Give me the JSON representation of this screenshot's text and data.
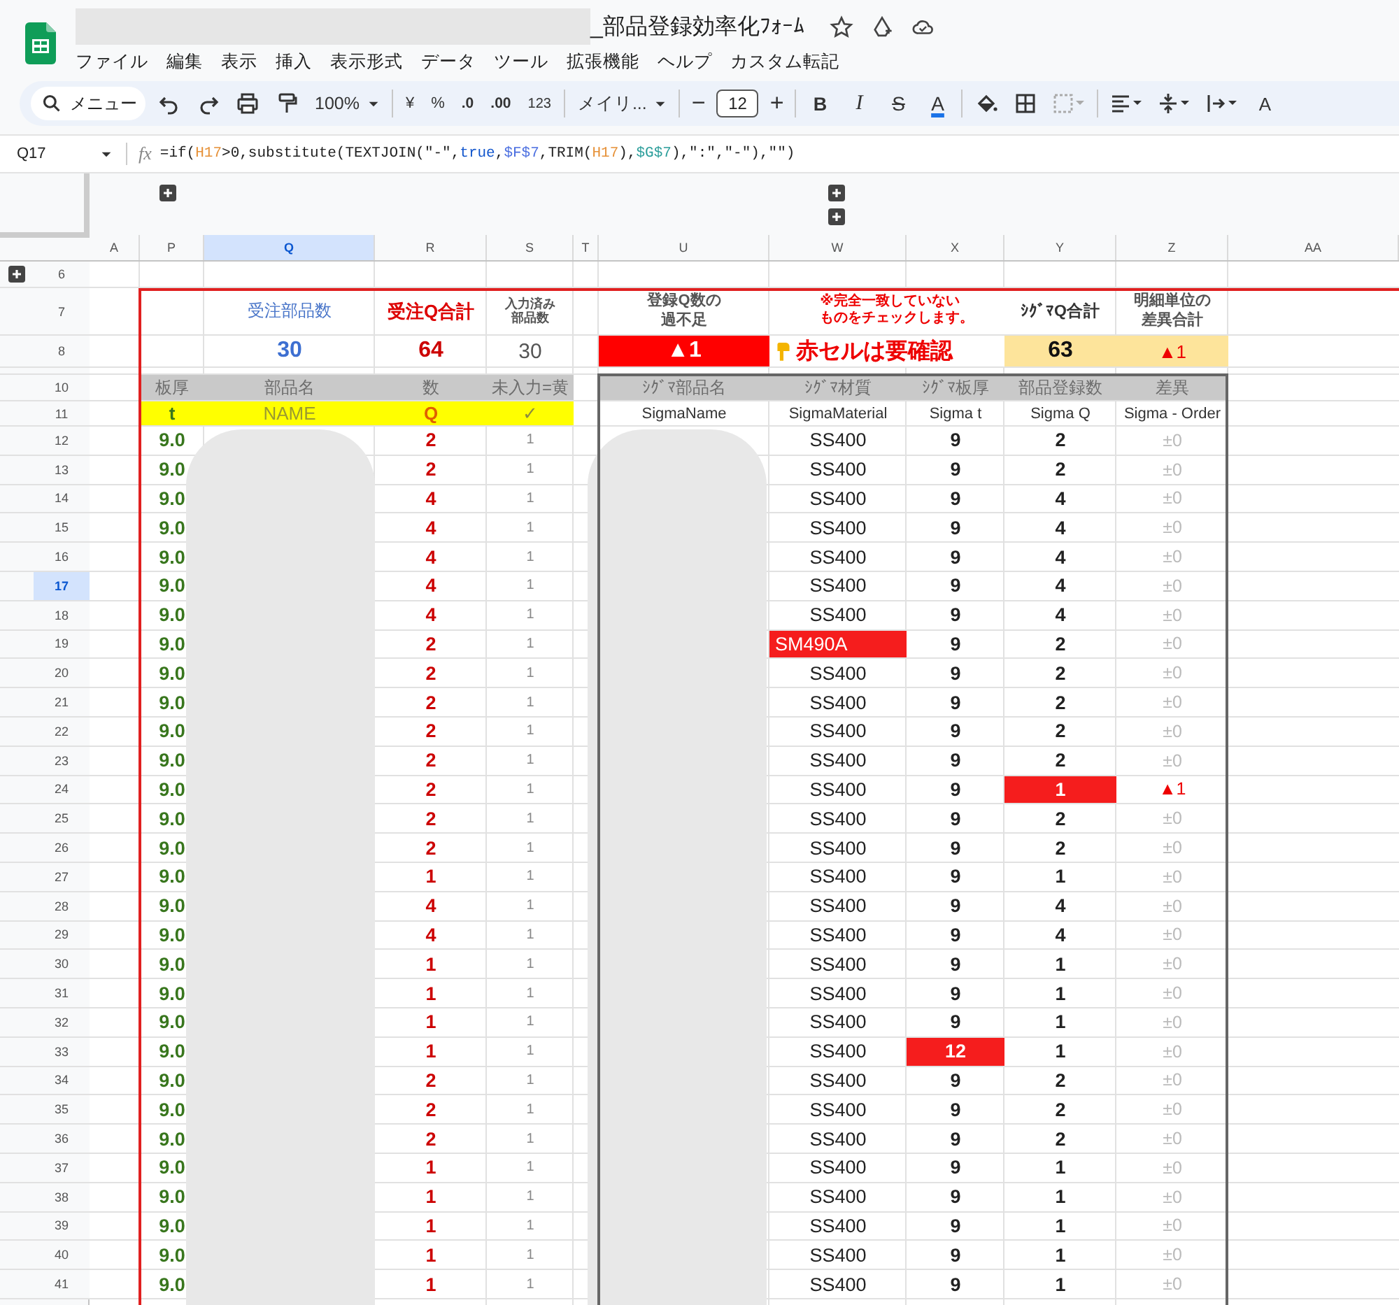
{
  "document": {
    "title": "_部品登録効率化ﾌｫｰﾑ"
  },
  "menu": [
    "ファイル",
    "編集",
    "表示",
    "挿入",
    "表示形式",
    "データ",
    "ツール",
    "拡張機能",
    "ヘルプ",
    "カスタム転記"
  ],
  "toolbar": {
    "search": "メニュー",
    "zoom": "100%",
    "currency": "¥",
    "percent": "%",
    "decimal_decrease": ".0",
    "decimal_increase": ".00",
    "number_format": "123",
    "font": "メイリ...",
    "size_minus": "−",
    "font_size": "12",
    "size_plus": "+",
    "bold": "B",
    "italic": "I",
    "strike": "S",
    "text_color": "A",
    "rotate": "A"
  },
  "formula_bar": {
    "cell": "Q17",
    "fx": "fx",
    "tokens": [
      {
        "text": "=if(",
        "kind": "plain"
      },
      {
        "text": "H17",
        "kind": "ref_a"
      },
      {
        "text": ">0,substitute(TEXTJOIN(\"-\",",
        "kind": "plain"
      },
      {
        "text": "true",
        "kind": "bool"
      },
      {
        "text": ",",
        "kind": "plain"
      },
      {
        "text": "$F$7",
        "kind": "ref_b"
      },
      {
        "text": ",TRIM(",
        "kind": "plain"
      },
      {
        "text": "H17",
        "kind": "ref_a"
      },
      {
        "text": "),",
        "kind": "plain"
      },
      {
        "text": "$G$7",
        "kind": "ref_c"
      },
      {
        "text": "),\":\",\"-\"),\"\")",
        "kind": "plain"
      }
    ]
  },
  "columns": [
    {
      "label": "A",
      "selected": false
    },
    {
      "label": "P",
      "selected": false
    },
    {
      "label": "Q",
      "selected": true
    },
    {
      "label": "R",
      "selected": false
    },
    {
      "label": "S",
      "selected": false
    },
    {
      "label": "T",
      "selected": false
    },
    {
      "label": "U",
      "selected": false
    },
    {
      "label": "W",
      "selected": false
    },
    {
      "label": "X",
      "selected": false
    },
    {
      "label": "Y",
      "selected": false
    },
    {
      "label": "Z",
      "selected": false
    },
    {
      "label": "AA",
      "selected": false
    }
  ],
  "row_labels": [
    "6",
    "7",
    "8",
    "10",
    "11"
  ],
  "summary": {
    "order_parts_label": "受注部品数",
    "order_q_label": "受注Q合計",
    "entered_label": "入力済み部品数",
    "shortage_label": "登録Q数の過不足",
    "notice": [
      "※完全一致していない",
      "ものをチェックします。"
    ],
    "sigma_q_label": "ｼｸﾞﾏQ合計",
    "diff_label": "明細単位の差異合計",
    "order_parts": "30",
    "order_q": "64",
    "entered": "30",
    "shortage": "▲1",
    "check_note": "赤セルは要確認",
    "sigma_q": "63",
    "diff_total": "▲1"
  },
  "order_headers": [
    "板厚",
    "部品名",
    "数",
    "未入力=黄"
  ],
  "order_keys": [
    "t",
    "NAME",
    "Q",
    "✓"
  ],
  "sigma_headers": [
    "ｼｸﾞﾏ部品名",
    "ｼｸﾞﾏ材質",
    "ｼｸﾞﾏ板厚",
    "部品登録数",
    "差異"
  ],
  "sigma_keys": [
    "SigmaName",
    "SigmaMaterial",
    "Sigma t",
    "Sigma Q",
    "Sigma - Order"
  ],
  "rows": [
    {
      "num": "12",
      "selected": false,
      "t": "9.0",
      "q": "2",
      "entered": "1",
      "material": "SS400",
      "material_flag": false,
      "sigma_t": "9",
      "t_flag": false,
      "sigma_q": "2",
      "q_flag": false,
      "diff": "±0",
      "diff_flag": false
    },
    {
      "num": "13",
      "selected": false,
      "t": "9.0",
      "q": "2",
      "entered": "1",
      "material": "SS400",
      "material_flag": false,
      "sigma_t": "9",
      "t_flag": false,
      "sigma_q": "2",
      "q_flag": false,
      "diff": "±0",
      "diff_flag": false
    },
    {
      "num": "14",
      "selected": false,
      "t": "9.0",
      "q": "4",
      "entered": "1",
      "material": "SS400",
      "material_flag": false,
      "sigma_t": "9",
      "t_flag": false,
      "sigma_q": "4",
      "q_flag": false,
      "diff": "±0",
      "diff_flag": false
    },
    {
      "num": "15",
      "selected": false,
      "t": "9.0",
      "q": "4",
      "entered": "1",
      "material": "SS400",
      "material_flag": false,
      "sigma_t": "9",
      "t_flag": false,
      "sigma_q": "4",
      "q_flag": false,
      "diff": "±0",
      "diff_flag": false
    },
    {
      "num": "16",
      "selected": false,
      "t": "9.0",
      "q": "4",
      "entered": "1",
      "material": "SS400",
      "material_flag": false,
      "sigma_t": "9",
      "t_flag": false,
      "sigma_q": "4",
      "q_flag": false,
      "diff": "±0",
      "diff_flag": false
    },
    {
      "num": "17",
      "selected": true,
      "t": "9.0",
      "q": "4",
      "entered": "1",
      "material": "SS400",
      "material_flag": false,
      "sigma_t": "9",
      "t_flag": false,
      "sigma_q": "4",
      "q_flag": false,
      "diff": "±0",
      "diff_flag": false
    },
    {
      "num": "18",
      "selected": false,
      "t": "9.0",
      "q": "4",
      "entered": "1",
      "material": "SS400",
      "material_flag": false,
      "sigma_t": "9",
      "t_flag": false,
      "sigma_q": "4",
      "q_flag": false,
      "diff": "±0",
      "diff_flag": false
    },
    {
      "num": "19",
      "selected": false,
      "t": "9.0",
      "q": "2",
      "entered": "1",
      "material": "SM490A",
      "material_flag": true,
      "sigma_t": "9",
      "t_flag": false,
      "sigma_q": "2",
      "q_flag": false,
      "diff": "±0",
      "diff_flag": false
    },
    {
      "num": "20",
      "selected": false,
      "t": "9.0",
      "q": "2",
      "entered": "1",
      "material": "SS400",
      "material_flag": false,
      "sigma_t": "9",
      "t_flag": false,
      "sigma_q": "2",
      "q_flag": false,
      "diff": "±0",
      "diff_flag": false
    },
    {
      "num": "21",
      "selected": false,
      "t": "9.0",
      "q": "2",
      "entered": "1",
      "material": "SS400",
      "material_flag": false,
      "sigma_t": "9",
      "t_flag": false,
      "sigma_q": "2",
      "q_flag": false,
      "diff": "±0",
      "diff_flag": false
    },
    {
      "num": "22",
      "selected": false,
      "t": "9.0",
      "q": "2",
      "entered": "1",
      "material": "SS400",
      "material_flag": false,
      "sigma_t": "9",
      "t_flag": false,
      "sigma_q": "2",
      "q_flag": false,
      "diff": "±0",
      "diff_flag": false
    },
    {
      "num": "23",
      "selected": false,
      "t": "9.0",
      "q": "2",
      "entered": "1",
      "material": "SS400",
      "material_flag": false,
      "sigma_t": "9",
      "t_flag": false,
      "sigma_q": "2",
      "q_flag": false,
      "diff": "±0",
      "diff_flag": false
    },
    {
      "num": "24",
      "selected": false,
      "t": "9.0",
      "q": "2",
      "entered": "1",
      "material": "SS400",
      "material_flag": false,
      "sigma_t": "9",
      "t_flag": false,
      "sigma_q": "1",
      "q_flag": true,
      "diff": "▲1",
      "diff_flag": true
    },
    {
      "num": "25",
      "selected": false,
      "t": "9.0",
      "q": "2",
      "entered": "1",
      "material": "SS400",
      "material_flag": false,
      "sigma_t": "9",
      "t_flag": false,
      "sigma_q": "2",
      "q_flag": false,
      "diff": "±0",
      "diff_flag": false
    },
    {
      "num": "26",
      "selected": false,
      "t": "9.0",
      "q": "2",
      "entered": "1",
      "material": "SS400",
      "material_flag": false,
      "sigma_t": "9",
      "t_flag": false,
      "sigma_q": "2",
      "q_flag": false,
      "diff": "±0",
      "diff_flag": false
    },
    {
      "num": "27",
      "selected": false,
      "t": "9.0",
      "q": "1",
      "entered": "1",
      "material": "SS400",
      "material_flag": false,
      "sigma_t": "9",
      "t_flag": false,
      "sigma_q": "1",
      "q_flag": false,
      "diff": "±0",
      "diff_flag": false
    },
    {
      "num": "28",
      "selected": false,
      "t": "9.0",
      "q": "4",
      "entered": "1",
      "material": "SS400",
      "material_flag": false,
      "sigma_t": "9",
      "t_flag": false,
      "sigma_q": "4",
      "q_flag": false,
      "diff": "±0",
      "diff_flag": false
    },
    {
      "num": "29",
      "selected": false,
      "t": "9.0",
      "q": "4",
      "entered": "1",
      "material": "SS400",
      "material_flag": false,
      "sigma_t": "9",
      "t_flag": false,
      "sigma_q": "4",
      "q_flag": false,
      "diff": "±0",
      "diff_flag": false
    },
    {
      "num": "30",
      "selected": false,
      "t": "9.0",
      "q": "1",
      "entered": "1",
      "material": "SS400",
      "material_flag": false,
      "sigma_t": "9",
      "t_flag": false,
      "sigma_q": "1",
      "q_flag": false,
      "diff": "±0",
      "diff_flag": false
    },
    {
      "num": "31",
      "selected": false,
      "t": "9.0",
      "q": "1",
      "entered": "1",
      "material": "SS400",
      "material_flag": false,
      "sigma_t": "9",
      "t_flag": false,
      "sigma_q": "1",
      "q_flag": false,
      "diff": "±0",
      "diff_flag": false
    },
    {
      "num": "32",
      "selected": false,
      "t": "9.0",
      "q": "1",
      "entered": "1",
      "material": "SS400",
      "material_flag": false,
      "sigma_t": "9",
      "t_flag": false,
      "sigma_q": "1",
      "q_flag": false,
      "diff": "±0",
      "diff_flag": false
    },
    {
      "num": "33",
      "selected": false,
      "t": "9.0",
      "q": "1",
      "entered": "1",
      "material": "SS400",
      "material_flag": false,
      "sigma_t": "12",
      "t_flag": true,
      "sigma_q": "1",
      "q_flag": false,
      "diff": "±0",
      "diff_flag": false
    },
    {
      "num": "34",
      "selected": false,
      "t": "9.0",
      "q": "2",
      "entered": "1",
      "material": "SS400",
      "material_flag": false,
      "sigma_t": "9",
      "t_flag": false,
      "sigma_q": "2",
      "q_flag": false,
      "diff": "±0",
      "diff_flag": false
    },
    {
      "num": "35",
      "selected": false,
      "t": "9.0",
      "q": "2",
      "entered": "1",
      "material": "SS400",
      "material_flag": false,
      "sigma_t": "9",
      "t_flag": false,
      "sigma_q": "2",
      "q_flag": false,
      "diff": "±0",
      "diff_flag": false
    },
    {
      "num": "36",
      "selected": false,
      "t": "9.0",
      "q": "2",
      "entered": "1",
      "material": "SS400",
      "material_flag": false,
      "sigma_t": "9",
      "t_flag": false,
      "sigma_q": "2",
      "q_flag": false,
      "diff": "±0",
      "diff_flag": false
    },
    {
      "num": "37",
      "selected": false,
      "t": "9.0",
      "q": "1",
      "entered": "1",
      "material": "SS400",
      "material_flag": false,
      "sigma_t": "9",
      "t_flag": false,
      "sigma_q": "1",
      "q_flag": false,
      "diff": "±0",
      "diff_flag": false
    },
    {
      "num": "38",
      "selected": false,
      "t": "9.0",
      "q": "1",
      "entered": "1",
      "material": "SS400",
      "material_flag": false,
      "sigma_t": "9",
      "t_flag": false,
      "sigma_q": "1",
      "q_flag": false,
      "diff": "±0",
      "diff_flag": false
    },
    {
      "num": "39",
      "selected": false,
      "t": "9.0",
      "q": "1",
      "entered": "1",
      "material": "SS400",
      "material_flag": false,
      "sigma_t": "9",
      "t_flag": false,
      "sigma_q": "1",
      "q_flag": false,
      "diff": "±0",
      "diff_flag": false
    },
    {
      "num": "40",
      "selected": false,
      "t": "9.0",
      "q": "1",
      "entered": "1",
      "material": "SS400",
      "material_flag": false,
      "sigma_t": "9",
      "t_flag": false,
      "sigma_q": "1",
      "q_flag": false,
      "diff": "±0",
      "diff_flag": false
    },
    {
      "num": "41",
      "selected": false,
      "t": "9.0",
      "q": "1",
      "entered": "1",
      "material": "SS400",
      "material_flag": false,
      "sigma_t": "9",
      "t_flag": false,
      "sigma_q": "1",
      "q_flag": false,
      "diff": "±0",
      "diff_flag": false
    }
  ]
}
